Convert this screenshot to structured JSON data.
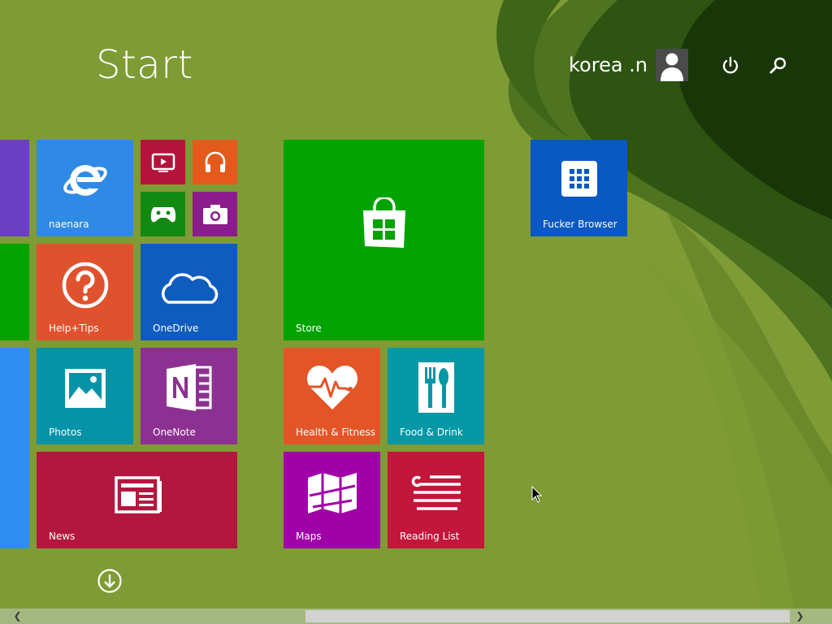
{
  "screen": {
    "title": "Start",
    "background_color": "#7e9b35",
    "accent_dark": "#1f3d09"
  },
  "user": {
    "name": "korea .n",
    "avatar_icon": "user-silhouette-icon",
    "power_icon": "power-icon",
    "search_icon": "search-icon"
  },
  "tiles": {
    "naenara": {
      "label": "naenara",
      "color": "#2f8ae6",
      "icon": "internet-explorer-icon"
    },
    "video": {
      "color": "#b5143a",
      "icon": "video-icon"
    },
    "music": {
      "color": "#e35a1c",
      "icon": "headphones-icon"
    },
    "games": {
      "color": "#128a12",
      "icon": "gamepad-icon"
    },
    "camera": {
      "color": "#8b1c8c",
      "icon": "camera-icon"
    },
    "help": {
      "label": "Help+Tips",
      "color": "#e0522e",
      "icon": "question-icon"
    },
    "onedrive": {
      "label": "OneDrive",
      "color": "#0f5cbf",
      "icon": "cloud-icon"
    },
    "photos": {
      "label": "Photos",
      "color": "#0593a7",
      "icon": "photo-icon"
    },
    "onenote": {
      "label": "OneNote",
      "color": "#8c3191",
      "icon": "onenote-icon"
    },
    "news": {
      "label": "News",
      "color": "#b3173f",
      "icon": "newspaper-icon"
    },
    "store": {
      "label": "Store",
      "color": "#00a300",
      "icon": "store-bag-icon"
    },
    "health": {
      "label": "Health & Fitness",
      "color": "#e35527",
      "icon": "heart-pulse-icon"
    },
    "food": {
      "label": "Food & Drink",
      "color": "#0497a5",
      "icon": "fork-knife-icon"
    },
    "maps": {
      "label": "Maps",
      "color": "#a000a8",
      "icon": "map-icon"
    },
    "reading": {
      "label": "Reading List",
      "color": "#c2163b",
      "icon": "reading-list-icon"
    },
    "browser": {
      "label": "Fucker Browser",
      "color": "#0a58c2",
      "icon": "app-grid-icon"
    },
    "edge_purple": {
      "color": "#6c3fc4"
    },
    "edge_green": {
      "color": "#00a300"
    },
    "edge_blue": {
      "color": "#2d8ef0"
    }
  },
  "all_apps": {
    "icon": "arrow-down-circle-icon"
  },
  "scrollbar": {
    "left_icon": "chevron-left-icon",
    "right_icon": "chevron-right-icon",
    "left_glyph": "❮",
    "right_glyph": "❯"
  }
}
